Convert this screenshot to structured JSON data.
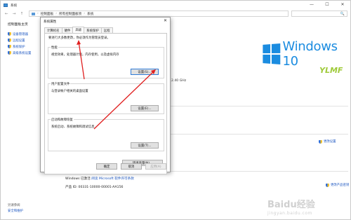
{
  "window": {
    "title": "系统",
    "controls": {
      "minimize": "—",
      "maximize": "☐",
      "close": "✕"
    }
  },
  "nav": {
    "back": "←",
    "forward": "→",
    "up": "↑",
    "breadcrumb": [
      "控制面板",
      "所有控制面板项",
      "系统"
    ],
    "separator": "›",
    "search_icon": "🔍"
  },
  "sidebar": {
    "home": "控制面板主页",
    "items": [
      {
        "label": "设备管理器",
        "icon": "shield-icon"
      },
      {
        "label": "远程设置",
        "icon": "shield-icon"
      },
      {
        "label": "系统保护",
        "icon": "shield-icon"
      },
      {
        "label": "高级系统设置",
        "icon": "shield-icon"
      }
    ],
    "footer_heading": "另请参阅",
    "footer_link": "安全和维护"
  },
  "main": {
    "brand_text": "Windows 10",
    "oem_logo": "YLMF",
    "processor_speed": "2.40 GHz",
    "change_settings": "更改设置",
    "activation_prefix": "Windows 已激活",
    "activation_link": "阅读 Microsoft 软件许可条款",
    "product_id": "产品 ID: 00331-10000-00001-AA156",
    "change_key": "更改产品密钥",
    "watermark_main": "Baidu经验",
    "watermark_sub": "jingyan.baidu.com"
  },
  "dialog": {
    "title": "系统属性",
    "close": "✕",
    "tabs": [
      "计算机名",
      "硬件",
      "高级",
      "系统保护",
      "远程"
    ],
    "active_tab": 2,
    "admin_note": "要进行大多数更改，你必须作为管理员登录。",
    "groups": [
      {
        "title": "性能",
        "desc": "视觉效果，处理器计划，内存使用，以及虚拟内存",
        "button": "设置(S)..."
      },
      {
        "title": "用户配置文件",
        "desc": "与登录帐户相关的桌面设置",
        "button": "设置(E)..."
      },
      {
        "title": "启动和故障恢复",
        "desc": "系统启动、系统故障和调试信息",
        "button": "设置(T)..."
      }
    ],
    "env_button": "环境变量(N)...",
    "ok": "确定",
    "cancel": "取消",
    "apply": "应用(A)"
  },
  "annotation": {
    "color": "#e02020"
  }
}
